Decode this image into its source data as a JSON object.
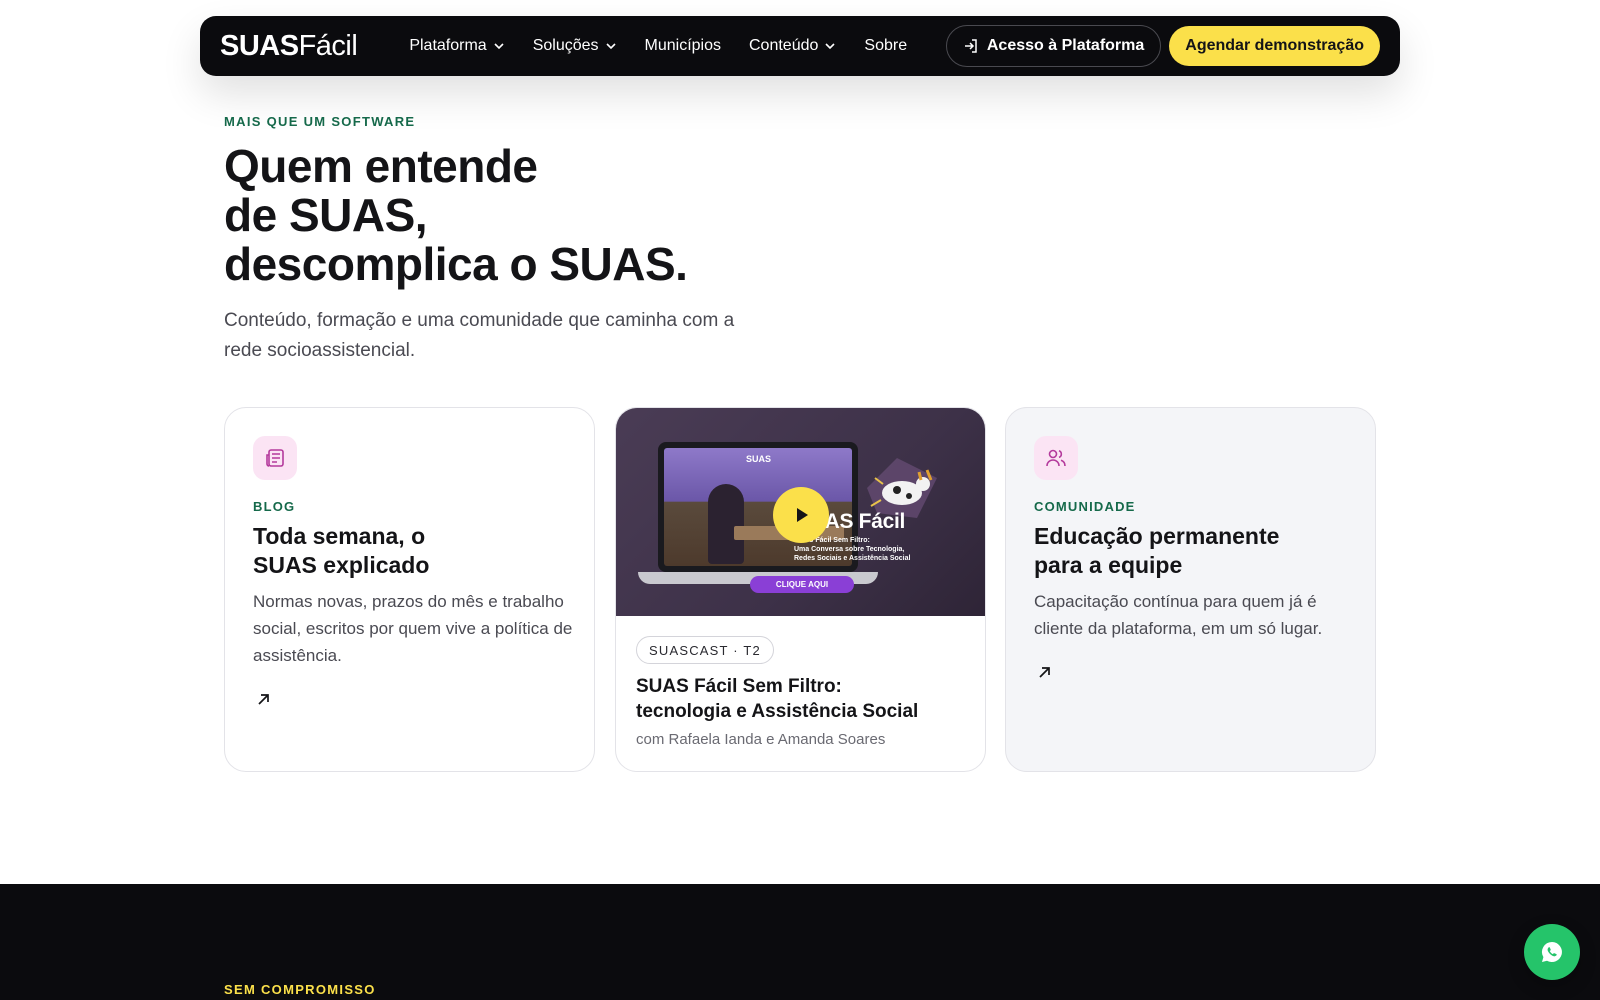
{
  "nav": {
    "logo_bold": "SUAS",
    "logo_light": "Fácil",
    "items": [
      {
        "label": "Plataforma",
        "dropdown": true
      },
      {
        "label": "Soluções",
        "dropdown": true
      },
      {
        "label": "Municípios",
        "dropdown": false
      },
      {
        "label": "Conteúdo",
        "dropdown": true
      },
      {
        "label": "Sobre",
        "dropdown": false
      }
    ],
    "access_label": "Acesso à Plataforma",
    "demo_label": "Agendar demonstração"
  },
  "hero": {
    "eyebrow": "MAIS QUE UM SOFTWARE",
    "headline_lines": [
      "Quem entende",
      "de SUAS,",
      "descomplica o SUAS."
    ],
    "subtitle": "Conteúdo, formação e uma comunidade que caminha com a rede socioassistencial."
  },
  "cards": {
    "blog": {
      "icon": "newspaper-icon",
      "tag": "BLOG",
      "title_lines": [
        "Toda semana, o",
        "SUAS explicado"
      ],
      "description": "Normas novas, prazos do mês e trabalho social, escritos por quem vive a política de assistência."
    },
    "podcast": {
      "thumbnail": {
        "mini_logo": "SUAS",
        "title": "SUAS Fácil",
        "subtitle_lines": [
          "SUAS Fácil Sem Filtro:",
          "Uma Conversa sobre Tecnologia,",
          "Redes Sociais e Assistência Social"
        ],
        "cta": "CLIQUE AQUI"
      },
      "pill": "SUASCAST · T2",
      "title_lines": [
        "SUAS Fácil Sem Filtro:",
        "tecnologia e Assistência Social"
      ],
      "meta": "com Rafaela Ianda e Amanda Soares"
    },
    "community": {
      "icon": "users-icon",
      "tag": "COMUNIDADE",
      "title_lines": [
        "Educação permanente",
        "para a equipe"
      ],
      "description": "Capacitação contínua para quem já é cliente da plataforma, em um só lugar."
    }
  },
  "dark_section": {
    "eyebrow": "SEM COMPROMISSO"
  },
  "colors": {
    "accent_yellow": "#fbe04a",
    "accent_green": "#15694a",
    "dark": "#0b0b0e",
    "whatsapp": "#25c46a"
  }
}
